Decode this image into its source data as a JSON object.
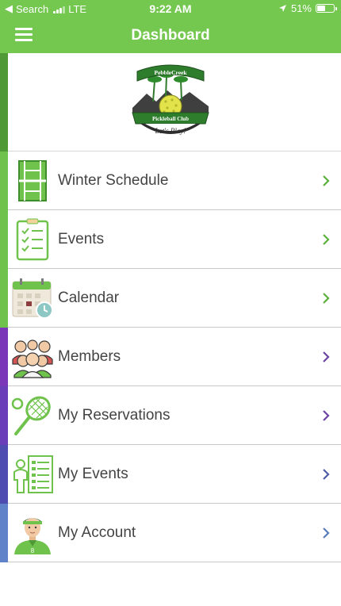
{
  "status_bar": {
    "carrier": "Search",
    "network": "LTE",
    "time": "9:22 AM",
    "battery": "51%",
    "battery_level": 0.51
  },
  "nav": {
    "title": "Dashboard",
    "menu_icon": "hamburger-menu-icon"
  },
  "logo": {
    "top_banner": "PebbleCreek",
    "middle_banner": "Pickleball Club",
    "motto": "Let's Play!"
  },
  "menu": {
    "items": [
      {
        "label": "Winter Schedule",
        "icon": "court-icon",
        "accent": "#6fc24b",
        "chevron": "#5bb03a"
      },
      {
        "label": "Events",
        "icon": "checklist-icon",
        "accent": "#6fc24b",
        "chevron": "#5bb03a"
      },
      {
        "label": "Calendar",
        "icon": "calendar-icon",
        "accent": "#6fc24b",
        "chevron": "#5bb03a"
      },
      {
        "label": "Members",
        "icon": "group-icon",
        "accent": "#7a38b8",
        "chevron": "#6b45a2"
      },
      {
        "label": "My Reservations",
        "icon": "racket-icon",
        "accent": "#6a3eb8",
        "chevron": "#6b45a2"
      },
      {
        "label": "My Events",
        "icon": "person-list-icon",
        "accent": "#4e4cb0",
        "chevron": "#4e5ca6"
      },
      {
        "label": "My Account",
        "icon": "player-avatar-icon",
        "accent": "#5f82c8",
        "chevron": "#5a7cba"
      }
    ]
  },
  "colors": {
    "brand_green": "#74c84f",
    "text": "#444444"
  }
}
